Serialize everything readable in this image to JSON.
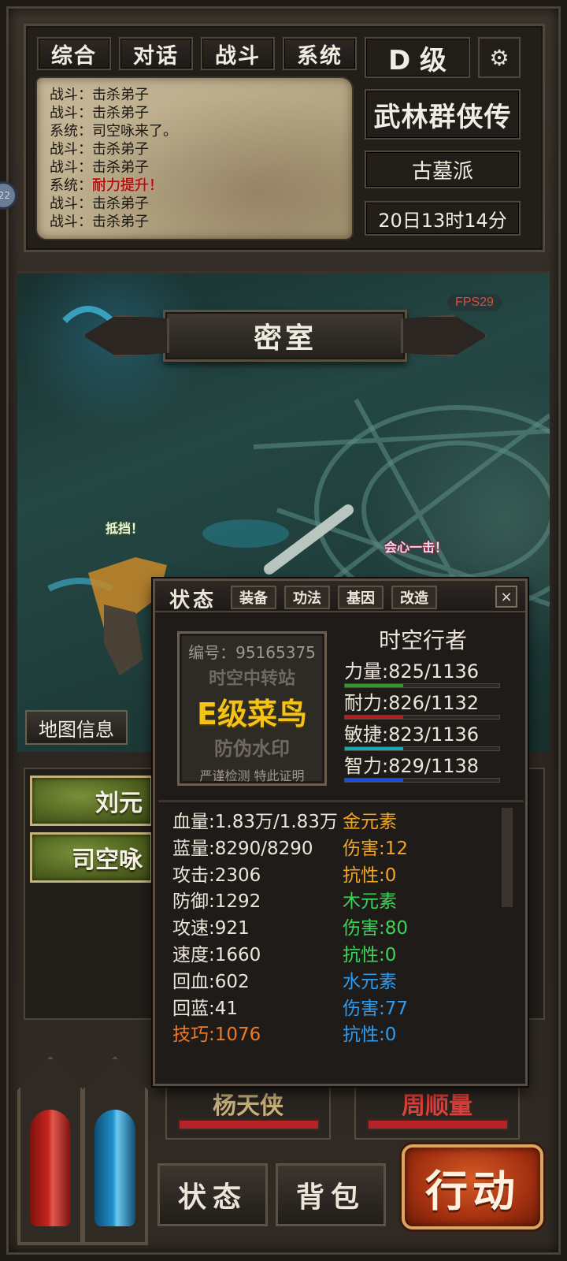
{
  "top_tabs": [
    "综合",
    "对话",
    "战斗",
    "系统"
  ],
  "log_lines": [
    {
      "prefix": "战斗：",
      "msg": "击杀弟子",
      "alert": false
    },
    {
      "prefix": "战斗：",
      "msg": "击杀弟子",
      "alert": false
    },
    {
      "prefix": "系统：",
      "msg": "司空咏来了。",
      "alert": false
    },
    {
      "prefix": "战斗：",
      "msg": "击杀弟子",
      "alert": false
    },
    {
      "prefix": "战斗：",
      "msg": "击杀弟子",
      "alert": false
    },
    {
      "prefix": "系统：",
      "msg": "耐力提升！",
      "alert": true
    },
    {
      "prefix": "战斗：",
      "msg": "击杀弟子",
      "alert": false
    },
    {
      "prefix": "战斗：",
      "msg": "击杀弟子",
      "alert": false
    }
  ],
  "side_bubble": "22",
  "header": {
    "grade": "D 级",
    "gear_icon": "gear-icon",
    "game_title": "武林群侠传",
    "sect": "古墓派",
    "datetime": "20日13时14分"
  },
  "scene": {
    "fps": "FPS29",
    "location": "密室",
    "float_block": "抵挡！",
    "float_crit": "会心一击！",
    "map_info": "地图信息"
  },
  "party": [
    "刘元",
    "司空咏"
  ],
  "dialog": {
    "title": "状态",
    "tabs": [
      "装备",
      "功法",
      "基因",
      "改造"
    ],
    "close": "×",
    "card": {
      "id": "编号：95165375",
      "watermark1": "时空中转站",
      "rank": "E级菜鸟",
      "watermark2": "防伪水印",
      "cert": "严谨检测 特此证明"
    },
    "char_name": "时空行者",
    "attributes": [
      {
        "label": "力量:825/1136",
        "current": 825,
        "max": 1136,
        "color": "#2f9b2a"
      },
      {
        "label": "耐力:826/1132",
        "current": 826,
        "max": 1132,
        "color": "#b32020"
      },
      {
        "label": "敏捷:823/1136",
        "current": 823,
        "max": 1136,
        "color": "#19a9b0"
      },
      {
        "label": "智力:829/1138",
        "current": 829,
        "max": 1138,
        "color": "#1c4fe0"
      }
    ],
    "details_left": [
      {
        "text": "血量:1.83万/1.83万",
        "color": "#ece6da"
      },
      {
        "text": "蓝量:8290/8290",
        "color": "#ece6da"
      },
      {
        "text": "攻击:2306",
        "color": "#ece6da"
      },
      {
        "text": "防御:1292",
        "color": "#ece6da"
      },
      {
        "text": "攻速:921",
        "color": "#ece6da"
      },
      {
        "text": "速度:1660",
        "color": "#ece6da"
      },
      {
        "text": "回血:602",
        "color": "#ece6da"
      },
      {
        "text": "回蓝:41",
        "color": "#ece6da"
      },
      {
        "text": "技巧:1076",
        "color": "#f07a23"
      }
    ],
    "details_right": [
      {
        "text": "金元素",
        "color": "#f0a623"
      },
      {
        "text": "伤害:12",
        "color": "#f0a623"
      },
      {
        "text": "抗性:0",
        "color": "#f0a623"
      },
      {
        "text": "木元素",
        "color": "#3ed35b"
      },
      {
        "text": "伤害:80",
        "color": "#3ed35b"
      },
      {
        "text": "抗性:0",
        "color": "#3ed35b"
      },
      {
        "text": "水元素",
        "color": "#2d9cf0"
      },
      {
        "text": "伤害:77",
        "color": "#2d9cf0"
      },
      {
        "text": "抗性:0",
        "color": "#2d9cf0"
      }
    ]
  },
  "enemies": [
    {
      "name": "杨天侠",
      "color": "#c9b27a"
    },
    {
      "name": "周顺量",
      "color": "#e0403c"
    }
  ],
  "hud": {
    "status_btn": "状态",
    "bag_btn": "背包",
    "action_btn": "行动",
    "hp_color": "#c8251e",
    "mp_color": "#1e8fc8"
  }
}
